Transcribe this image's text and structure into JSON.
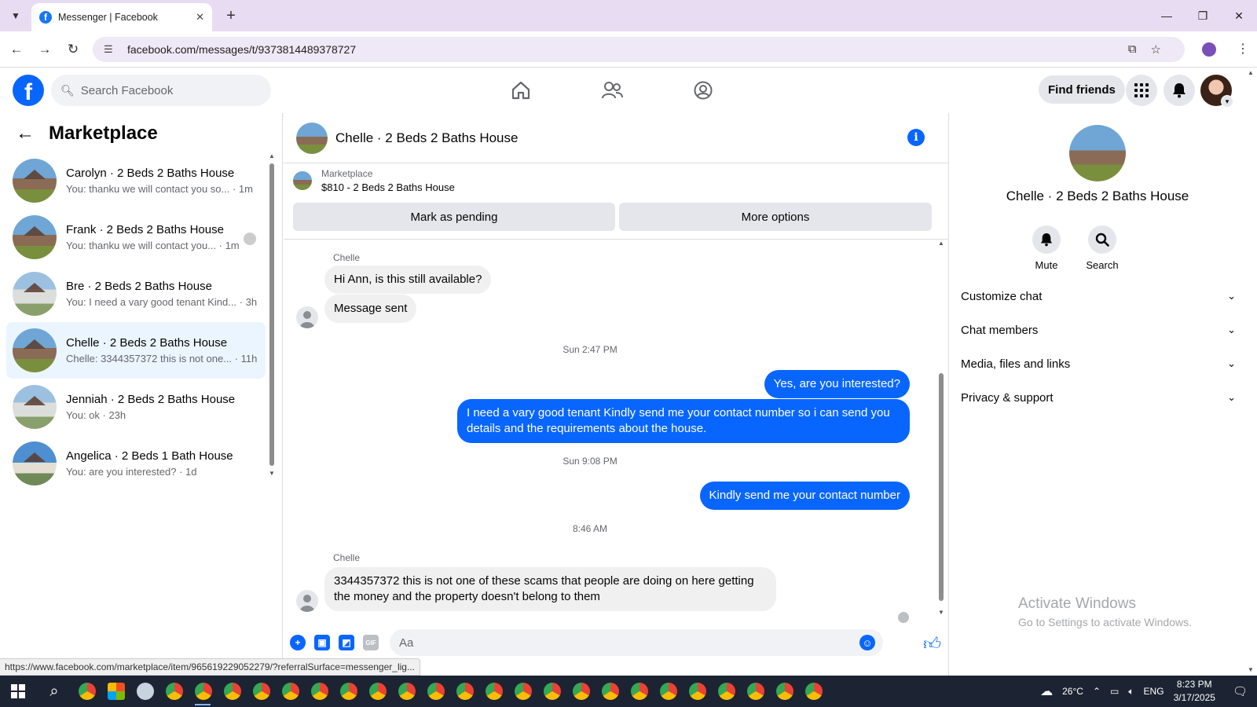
{
  "browser": {
    "tab_title": "Messenger | Facebook",
    "url": "facebook.com/messages/t/9373814489378727",
    "status_url": "https://www.facebook.com/marketplace/item/965619229052279/?referralSurface=messenger_lig..."
  },
  "header": {
    "search_placeholder": "Search Facebook",
    "find_friends": "Find friends"
  },
  "sidebar": {
    "title": "Marketplace",
    "conversations": [
      {
        "name": "Carolyn · 2 Beds 2 Baths House",
        "snippet": "You: thanku we will contact you so... · 1m"
      },
      {
        "name": "Frank · 2 Beds 2 Baths House",
        "snippet": "You: thanku we will contact you... · 1m"
      },
      {
        "name": "Bre · 2 Beds 2 Baths House",
        "snippet": "You: I need a vary good tenant Kind... · 3h"
      },
      {
        "name": "Chelle · 2 Beds 2 Baths House",
        "snippet": "Chelle: 3344357372 this is not one... · 11h"
      },
      {
        "name": "Jenniah · 2 Beds 2 Baths House",
        "snippet": "You: ok · 23h"
      },
      {
        "name": "Angelica · 2 Beds 1 Bath House",
        "snippet": "You: are you interested? · 1d"
      }
    ]
  },
  "chat": {
    "title": "Chelle · 2 Beds 2 Baths House",
    "listing_label": "Marketplace",
    "listing_price": "$810 - 2 Beds 2 Baths House",
    "mark_pending": "Mark as pending",
    "more_options": "More options",
    "sender_1": "Chelle",
    "msg_1": "Hi Ann, is this still available?",
    "msg_2": "Message sent",
    "time_1": "Sun 2:47 PM",
    "msg_3": "Yes, are you interested?",
    "msg_4": "I need a vary good tenant Kindly send me your contact number so i can send you details and the requirements about the house.",
    "time_2": "Sun 9:08 PM",
    "msg_5": "Kindly send me your contact number",
    "time_3": "8:46 AM",
    "sender_2": "Chelle",
    "msg_6": "3344357372 this is not one of these scams that people are doing on here getting the money and the property doesn't belong to them",
    "composer_placeholder": "Aa"
  },
  "details": {
    "name": "Chelle · 2 Beds 2 Baths House",
    "mute": "Mute",
    "search": "Search",
    "sections": [
      "Customize chat",
      "Chat members",
      "Media, files and links",
      "Privacy & support"
    ]
  },
  "watermark": {
    "title": "Activate Windows",
    "subtitle": "Go to Settings to activate Windows."
  },
  "taskbar": {
    "weather": "26°C",
    "lang": "ENG",
    "time": "8:23 PM",
    "date": "3/17/2025"
  },
  "colors": {
    "fb_blue": "#0866ff",
    "active_conv": "#ebf5ff",
    "incoming_bubble": "#f0f0f0"
  }
}
